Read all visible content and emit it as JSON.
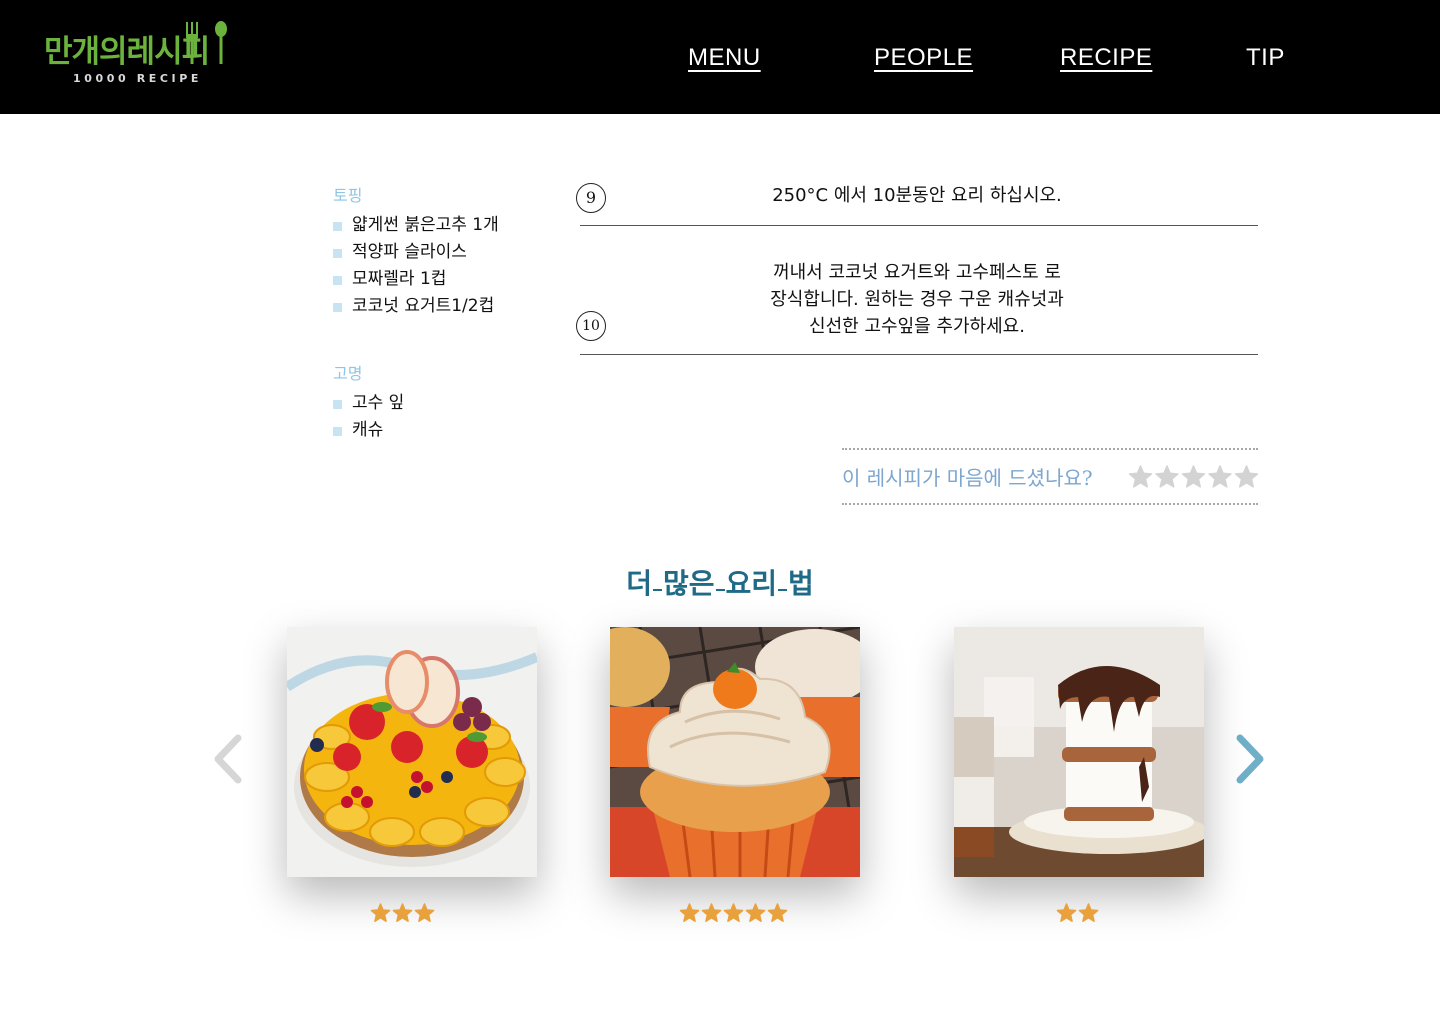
{
  "header": {
    "logo_text": "만개의레시피",
    "logo_subtext": "10000 RECIPE",
    "nav": [
      "MENU",
      "PEOPLE",
      "RECIPE",
      "TIP"
    ]
  },
  "ingredients": {
    "groups": [
      {
        "heading": "토핑",
        "items": [
          "얇게썬 붉은고추 1개",
          "적양파 슬라이스",
          "모짜렐라 1컵",
          "코코넛 요거트1/2컵"
        ]
      },
      {
        "heading": "고명",
        "items": [
          "고수 잎",
          "캐슈"
        ]
      }
    ]
  },
  "steps": [
    {
      "number": "9",
      "lines": [
        "250°C 에서 10분동안 요리 하십시오."
      ]
    },
    {
      "number": "10",
      "lines": [
        "꺼내서 코코넛 요거트와 고수페스토 로",
        "장식합니다. 원하는 경우 구운 캐슈넛과",
        "신선한 고수잎을 추가하세요."
      ]
    }
  ],
  "rating_prompt": {
    "question": "이 레시피가 마음에 드셨나요?",
    "stars_filled": 0,
    "stars_total": 5
  },
  "more_recipes": {
    "title": "더 많은 요리 법",
    "cards": [
      {
        "image": "fruit-tart",
        "rating": 3
      },
      {
        "image": "pumpkin-cupcake",
        "rating": 5
      },
      {
        "image": "ice-cream-sandwich",
        "rating": 2
      }
    ]
  },
  "icons": {
    "prev": "chevron-left-icon",
    "next": "chevron-right-icon",
    "star": "star-icon"
  },
  "colors": {
    "header_bg": "#000000",
    "logo_green": "#6cb33e",
    "ingredient_heading": "#8ec6e6",
    "bullet": "#c8e4f3",
    "rating_question": "#7ea6cf",
    "empty_star": "#d3d3d3",
    "card_star": "#e8a13c",
    "section_title": "#1e6a87",
    "next_arrow": "#6fb0c8",
    "prev_arrow": "#d6d6d6"
  }
}
